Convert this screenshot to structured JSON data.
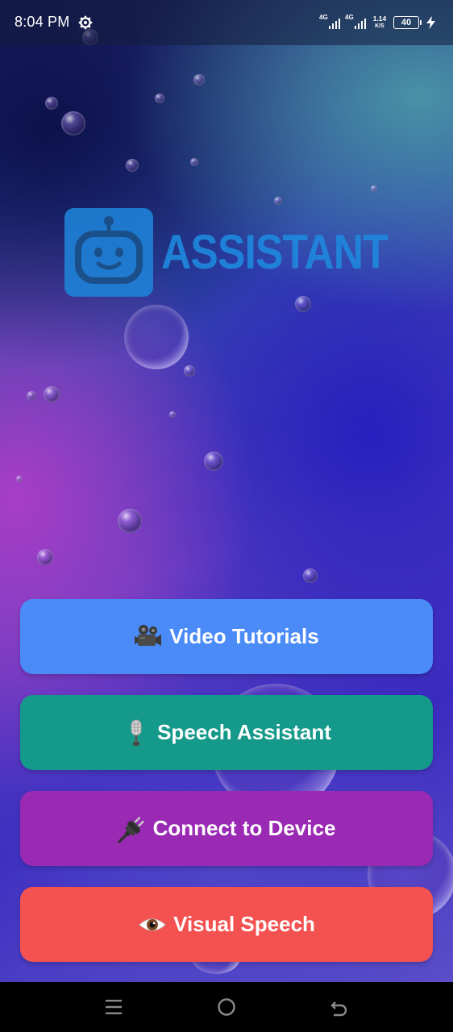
{
  "status_bar": {
    "time": "8:04 PM",
    "sim1_tag": "4G",
    "sim2_tag": "4G",
    "net_speed_value": "1.14",
    "net_speed_unit": "K/S",
    "battery_level": "40",
    "charging": true
  },
  "logo": {
    "text": "ASSISTANT",
    "icon": "robot-icon",
    "color": "#1e87dc"
  },
  "buttons": [
    {
      "label": "Video Tutorials",
      "icon": "video-camera-icon",
      "color": "#4a8bf7"
    },
    {
      "label": "Speech Assistant",
      "icon": "microphone-icon",
      "color": "#15998a"
    },
    {
      "label": "Connect to Device",
      "icon": "plug-icon",
      "color": "#9a2ab3"
    },
    {
      "label": "Visual Speech",
      "icon": "eye-icon",
      "color": "#f45151"
    }
  ],
  "nav_bar": {
    "items": [
      "menu-icon",
      "home-icon",
      "back-icon"
    ]
  }
}
